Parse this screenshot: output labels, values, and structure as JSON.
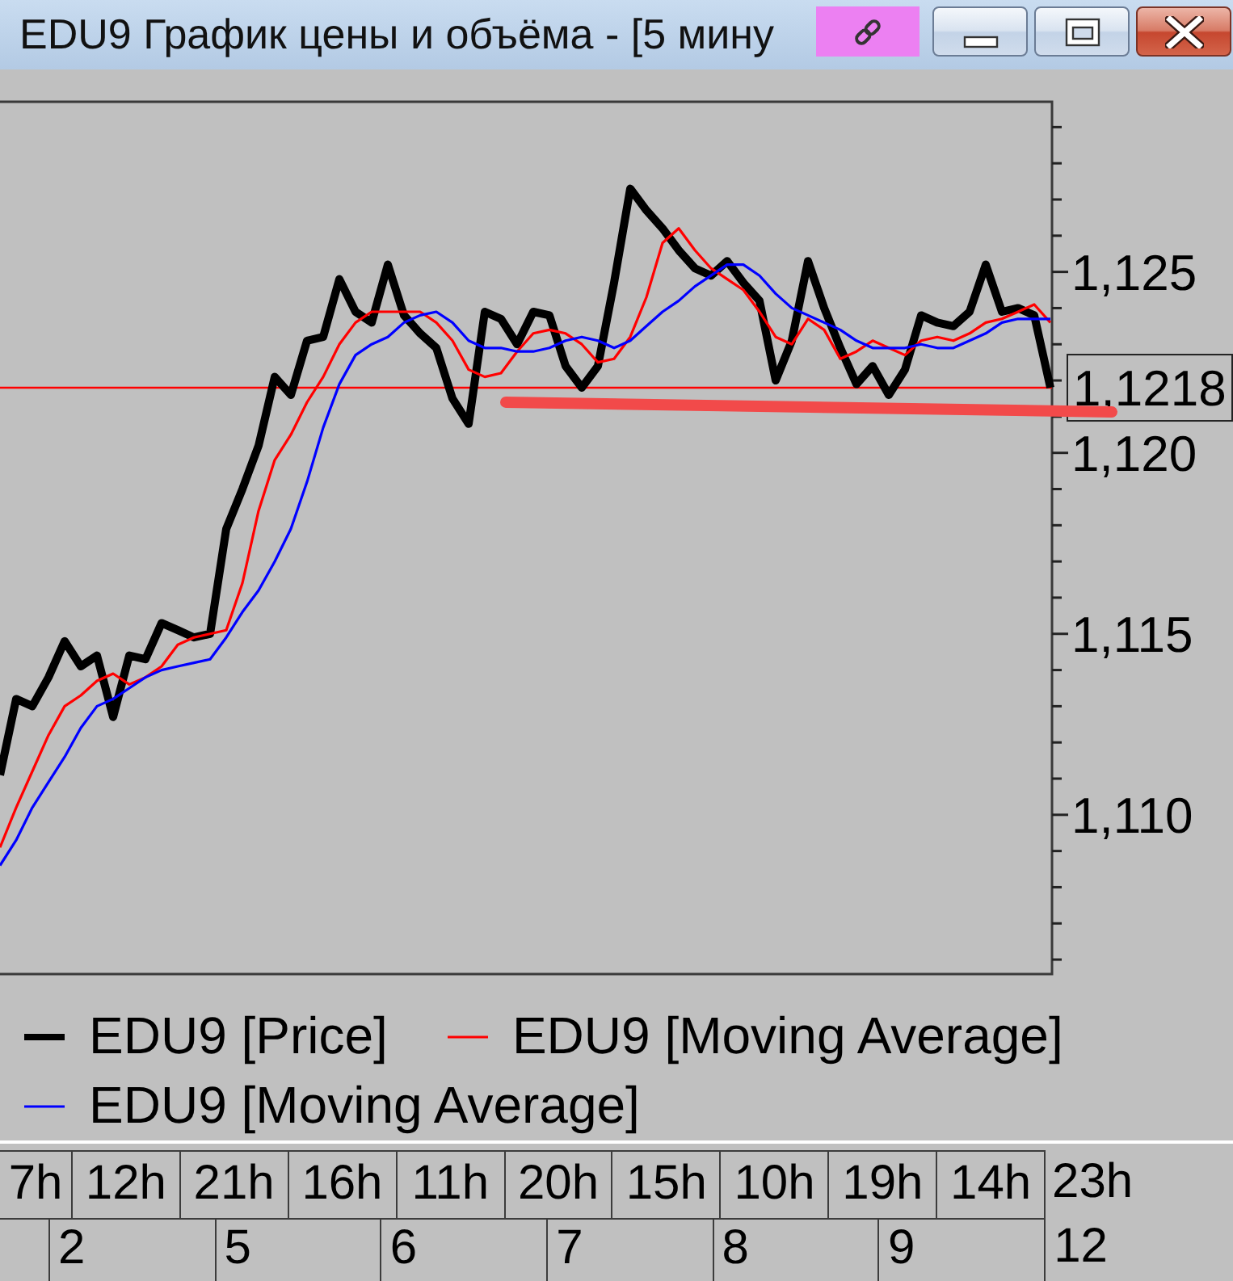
{
  "window": {
    "title": "EDU9 График цены и объёма - [5 мину"
  },
  "chart": {
    "lines": [
      {
        "kind": "price"
      },
      {
        "kind": "moving_average"
      },
      {
        "kind": "moving_average"
      }
    ],
    "last_price_label": "1,1218",
    "chart_data": {
      "type": "line",
      "ylim": [
        1105.6,
        1129.7
      ],
      "yticks": [
        {
          "value": 1110,
          "label": "1,110"
        },
        {
          "value": 1115,
          "label": "1,115"
        },
        {
          "value": 1120,
          "label": "1,120"
        },
        {
          "value": 1125,
          "label": "1,125"
        }
      ],
      "series": [
        {
          "name": "EDU9 [Price]",
          "color": "#000000",
          "values": [
            1111.1,
            1113.2,
            1113.0,
            1113.8,
            1114.8,
            1114.1,
            1114.4,
            1112.7,
            1114.4,
            1114.3,
            1115.3,
            1115.1,
            1114.9,
            1115.0,
            1117.9,
            1119.0,
            1120.2,
            1122.1,
            1121.6,
            1123.1,
            1123.2,
            1124.8,
            1123.9,
            1123.6,
            1125.2,
            1123.8,
            1123.3,
            1122.9,
            1121.5,
            1120.8,
            1123.9,
            1123.7,
            1123.0,
            1123.9,
            1123.8,
            1122.4,
            1121.8,
            1122.4,
            1124.7,
            1127.3,
            1126.7,
            1126.2,
            1125.6,
            1125.1,
            1124.9,
            1125.3,
            1124.7,
            1124.2,
            1122.0,
            1123.1,
            1125.3,
            1124.0,
            1122.9,
            1121.9,
            1122.4,
            1121.6,
            1122.3,
            1123.8,
            1123.6,
            1123.5,
            1123.9,
            1125.2,
            1123.9,
            1124.0,
            1123.8,
            1121.8
          ]
        },
        {
          "name": "EDU9 [Moving Average]",
          "color": "#ff0000",
          "values": [
            1109.1,
            1110.2,
            1111.2,
            1112.2,
            1113.0,
            1113.3,
            1113.7,
            1113.9,
            1113.6,
            1113.8,
            1114.1,
            1114.7,
            1114.9,
            1115.0,
            1115.1,
            1116.4,
            1118.4,
            1119.8,
            1120.5,
            1121.4,
            1122.1,
            1123.0,
            1123.6,
            1123.9,
            1123.9,
            1123.9,
            1123.9,
            1123.6,
            1123.1,
            1122.3,
            1122.1,
            1122.2,
            1122.8,
            1123.3,
            1123.4,
            1123.3,
            1123.0,
            1122.5,
            1122.6,
            1123.2,
            1124.3,
            1125.8,
            1126.2,
            1125.6,
            1125.1,
            1124.8,
            1124.5,
            1123.9,
            1123.2,
            1123.0,
            1123.7,
            1123.4,
            1122.6,
            1122.8,
            1123.1,
            1122.9,
            1122.7,
            1123.1,
            1123.2,
            1123.1,
            1123.3,
            1123.6,
            1123.7,
            1123.9,
            1124.1,
            1123.6
          ]
        },
        {
          "name": "EDU9 [Moving Average]",
          "color": "#0000ff",
          "values": [
            1108.6,
            1109.3,
            1110.2,
            1110.9,
            1111.6,
            1112.4,
            1113.0,
            1113.2,
            1113.5,
            1113.8,
            1114.0,
            1114.1,
            1114.2,
            1114.3,
            1114.9,
            1115.6,
            1116.2,
            1117.0,
            1117.9,
            1119.2,
            1120.7,
            1121.9,
            1122.7,
            1123.0,
            1123.2,
            1123.6,
            1123.8,
            1123.9,
            1123.6,
            1123.1,
            1122.9,
            1122.9,
            1122.8,
            1122.8,
            1122.9,
            1123.1,
            1123.2,
            1123.1,
            1122.9,
            1123.1,
            1123.5,
            1123.9,
            1124.2,
            1124.6,
            1124.9,
            1125.2,
            1125.2,
            1124.9,
            1124.4,
            1124.0,
            1123.8,
            1123.6,
            1123.4,
            1123.1,
            1122.9,
            1122.9,
            1122.9,
            1123.0,
            1122.9,
            1122.9,
            1123.1,
            1123.3,
            1123.6,
            1123.7,
            1123.7,
            1123.7
          ]
        }
      ],
      "ref_lines": [
        {
          "axis": "y",
          "value": 1121.8
        }
      ]
    }
  },
  "time_axis": {
    "hours": [
      "7h",
      "12h",
      "21h",
      "16h",
      "11h",
      "20h",
      "15h",
      "10h",
      "19h",
      "14h",
      "23h"
    ],
    "days": [
      "2",
      "5",
      "6",
      "7",
      "8",
      "9",
      "12"
    ]
  }
}
